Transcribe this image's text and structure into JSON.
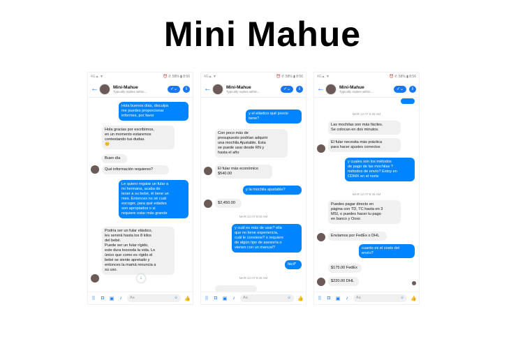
{
  "title": "Mini Mahue",
  "phones": [
    {
      "status": {
        "left": "4G▲ ▼",
        "right": "⏰ ✆ 58% ▮ 8:56"
      },
      "header": {
        "name": "Mini-Mahue",
        "subtitle": "Typically replies within..."
      },
      "messages": [
        {
          "text": "Hola buenos días, disculpa\nme puedes proporcionar\ninformes, por favor"
        },
        {
          "text": "Hola gracias por escribirnos,\nen un momento estaremos\ncontestando tus dudas.\n😊"
        },
        {
          "text": "Buen día"
        },
        {
          "text": "Qué información requieres?"
        },
        {
          "text": "Le quiero regalar un fular a\nmi hermana, acaba de\ntener a su bebé, él tiene un\nmes. Entonces no sé cuál\nescoger, para qué edades\nson apropiados o si\nrequiere estar más grande"
        },
        {
          "text": "Podría ser un fular elástico,\nles servirá hasta los 8 kilos\ndel bebé.\nPuede ser un fular rígido,\neste dura tooooda la vida. Lo\núnico que como es rígido el\nbebé se siente apretado y\nentonces la mamá renuncia a\nsu uso."
        }
      ],
      "composer": {
        "placeholder": "Aa",
        "emoji": "☺"
      }
    },
    {
      "status": {
        "left": "4G▲ ▼",
        "right": "⏰ ✆ 58% ▮ 8:56"
      },
      "header": {
        "name": "Mini-Mahue",
        "subtitle": "Typically replies within..."
      },
      "messages": [
        {
          "text": "y el elástico qué precio\ntiene?"
        },
        {
          "text": "Con poco más de\npresupuesto podrían adquirir\nuna mochila Ajustable. Esta\nse puede usar desde RN y\nhasta el año"
        },
        {
          "text": "El fular más económico\n$540.00"
        },
        {
          "text": "y la mochila ajustable?"
        },
        {
          "text": "$2,450.00"
        },
        {
          "text": "MAR 12 AT 9:04 AM"
        },
        {
          "text": "y cuál es más de usar? ella\nque no tiene experiencia,\ncuál le conviene? o requiere\nde algún tipo de asesoría o\nvienen con un manual?"
        },
        {
          "text": "fácil*"
        },
        {
          "text": "MAR 12 AT 9:26 AM"
        }
      ],
      "composer": {
        "placeholder": "Aa",
        "emoji": "☺"
      }
    },
    {
      "status": {
        "left": "4G▲ ▼",
        "right": "⏰ ✆ 58% ▮ 8:56"
      },
      "header": {
        "name": "Mini-Mahue",
        "subtitle": "Typically replies within..."
      },
      "messages": [
        {
          "text": "MAR 12 AT 9:26 AM"
        },
        {
          "text": "Las mochilas son más fáciles.\nSe colocan en dos minutos."
        },
        {
          "text": "El fular necesita más práctica\npara hacer ajustes correctos"
        },
        {
          "text": "y cuales son los métodos\nde pago de las mochilas ?\nmétodos de envío? Estoy en\nCDMX en el norte"
        },
        {
          "text": "MAR 12 AT 9:46 AM"
        },
        {
          "text": "Puedes pagar directo en\npágina con TD, TC hasta en 3\nMSI, o puedes hacer tu pago\nen banco y Oxxo"
        },
        {
          "text": "Enviamos por FedEx o DHL"
        },
        {
          "text": "cuanto es el costo del\nenvío?"
        },
        {
          "text": "$175.00 FedEx"
        },
        {
          "text": "$220.00 DHL"
        }
      ],
      "composer": {
        "placeholder": "Aa",
        "emoji": "☺"
      }
    }
  ]
}
